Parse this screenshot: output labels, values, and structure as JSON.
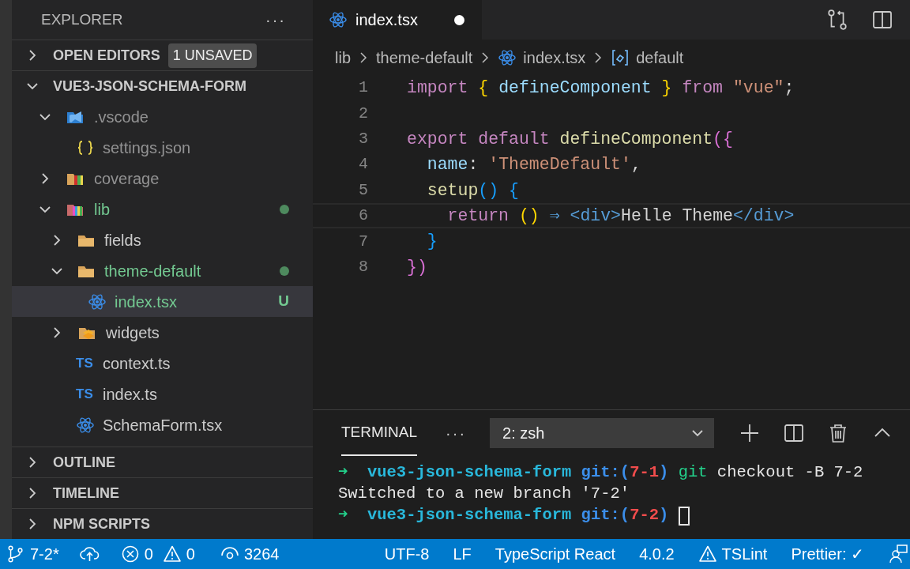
{
  "sidebar": {
    "title": "EXPLORER",
    "more": "···",
    "sections": [
      {
        "kind": "header",
        "label": "OPEN EDITORS",
        "expanded": false,
        "badge": "1 UNSAVED"
      },
      {
        "kind": "project",
        "label": "VUE3-JSON-SCHEMA-FORM",
        "expanded": true,
        "tree": [
          {
            "label": ".vscode",
            "kind": "vscode-folder",
            "ignored": true,
            "untracked": false,
            "expanded": true,
            "selected": false,
            "children": [
              {
                "label": "settings.json",
                "kind": "json",
                "ignored": true,
                "untracked": false,
                "selected": false
              }
            ]
          },
          {
            "label": "coverage",
            "kind": "coverage-folder",
            "ignored": true,
            "untracked": false,
            "expanded": false,
            "selected": false
          },
          {
            "label": "lib",
            "kind": "lib-folder",
            "ignored": false,
            "untracked": true,
            "expanded": true,
            "modified": true,
            "selected": false,
            "children": [
              {
                "label": "fields",
                "kind": "folder",
                "ignored": false,
                "untracked": false,
                "expanded": false,
                "selected": false
              },
              {
                "label": "theme-default",
                "kind": "folder",
                "ignored": false,
                "untracked": true,
                "expanded": true,
                "modified": true,
                "selected": false,
                "children": [
                  {
                    "label": "index.tsx",
                    "kind": "react",
                    "ignored": false,
                    "untracked": true,
                    "badge": "U",
                    "selected": true
                  }
                ]
              },
              {
                "label": "widgets",
                "kind": "widgets-folder",
                "ignored": false,
                "untracked": false,
                "expanded": false,
                "selected": false
              },
              {
                "label": "context.ts",
                "kind": "ts",
                "icon_text": "TS",
                "ignored": false,
                "untracked": false,
                "selected": false
              },
              {
                "label": "index.ts",
                "kind": "ts",
                "icon_text": "TS",
                "ignored": false,
                "untracked": false,
                "selected": false
              },
              {
                "label": "SchemaForm.tsx",
                "kind": "react",
                "ignored": false,
                "untracked": false,
                "selected": false
              }
            ]
          }
        ]
      },
      {
        "kind": "header",
        "label": "OUTLINE",
        "expanded": false
      },
      {
        "kind": "header",
        "label": "TIMELINE",
        "expanded": false
      },
      {
        "kind": "header",
        "label": "NPM SCRIPTS",
        "expanded": false
      }
    ]
  },
  "editor": {
    "tab": {
      "label": "index.tsx",
      "unsaved": true,
      "selected": true
    },
    "breadcrumb": [
      {
        "label": "lib",
        "kind": "folder"
      },
      {
        "label": "theme-default",
        "kind": "folder"
      },
      {
        "label": "index.tsx",
        "kind": "react"
      },
      {
        "label": "default",
        "kind": "symbol"
      }
    ],
    "lines": [
      {
        "number": "1",
        "tokens": [
          {
            "kind": "keyword",
            "text": "import "
          },
          {
            "kind": "brace",
            "text": "{ "
          },
          {
            "kind": "variable",
            "text": "defineComponent"
          },
          {
            "kind": "brace",
            "text": " } "
          },
          {
            "kind": "keyword",
            "text": "from "
          },
          {
            "kind": "string",
            "text": "\"vue\""
          },
          {
            "kind": "plain",
            "text": ";"
          }
        ]
      },
      {
        "number": "2"
      },
      {
        "number": "3",
        "tokens": [
          {
            "kind": "keyword",
            "text": "export default "
          },
          {
            "kind": "function",
            "text": "defineComponent"
          },
          {
            "kind": "brace2",
            "text": "({"
          }
        ]
      },
      {
        "number": "4",
        "tokens": [
          {
            "kind": "variable",
            "text": "  name"
          },
          {
            "kind": "plain",
            "text": ": "
          },
          {
            "kind": "string",
            "text": "'ThemeDefault'"
          },
          {
            "kind": "plain",
            "text": ","
          }
        ]
      },
      {
        "number": "5",
        "tokens": [
          {
            "kind": "function",
            "text": "  setup"
          },
          {
            "kind": "brace3",
            "text": "() {"
          }
        ]
      },
      {
        "number": "6",
        "current": true,
        "tokens": [
          {
            "kind": "keyword",
            "text": "    return "
          },
          {
            "kind": "brace",
            "text": "() "
          },
          {
            "kind": "operator",
            "text": "⇒ "
          },
          {
            "kind": "tag",
            "text": "<div>"
          },
          {
            "kind": "plain",
            "text": "Helle Theme"
          },
          {
            "kind": "tag",
            "text": "</div>"
          }
        ]
      },
      {
        "number": "7",
        "tokens": [
          {
            "kind": "brace3",
            "text": "  }"
          }
        ]
      },
      {
        "number": "8",
        "tokens": [
          {
            "kind": "brace2",
            "text": "})"
          }
        ]
      }
    ]
  },
  "panel": {
    "tab": {
      "label": "TERMINAL",
      "selected": true
    },
    "more": "···",
    "terminal_select": "2: zsh",
    "lines": [
      {
        "tokens": [
          {
            "kind": "arrow",
            "text": "➜  "
          },
          {
            "kind": "dir",
            "text": "vue3-json-schema-form "
          },
          {
            "kind": "git",
            "text": "git:("
          },
          {
            "kind": "branch",
            "text": "7-1"
          },
          {
            "kind": "git",
            "text": ") "
          },
          {
            "kind": "cmd",
            "text": "git "
          },
          {
            "kind": "plain",
            "text": "checkout -B 7-2"
          }
        ]
      },
      {
        "tokens": [
          {
            "kind": "plain",
            "text": "Switched to a new branch '7-2'"
          }
        ]
      },
      {
        "tokens": [
          {
            "kind": "arrow",
            "text": "➜  "
          },
          {
            "kind": "dir",
            "text": "vue3-json-schema-form "
          },
          {
            "kind": "git",
            "text": "git:("
          },
          {
            "kind": "branch",
            "text": "7-2"
          },
          {
            "kind": "git",
            "text": ") "
          }
        ],
        "cursor": true
      }
    ]
  },
  "status_bar": {
    "left": [
      {
        "kind": "branch",
        "text": "7-2*"
      },
      {
        "kind": "cloud"
      },
      {
        "kind": "error",
        "text": "0"
      },
      {
        "kind": "warning",
        "text": "0"
      },
      {
        "kind": "eye",
        "text": "3264"
      }
    ],
    "right": [
      {
        "kind": "text",
        "text": "UTF-8"
      },
      {
        "kind": "text",
        "text": "LF"
      },
      {
        "kind": "text",
        "text": "TypeScript React"
      },
      {
        "kind": "text",
        "text": "4.0.2"
      },
      {
        "kind": "warning",
        "text": "TSLint"
      },
      {
        "kind": "text",
        "text": "Prettier: ✓"
      },
      {
        "kind": "feedback"
      }
    ]
  }
}
